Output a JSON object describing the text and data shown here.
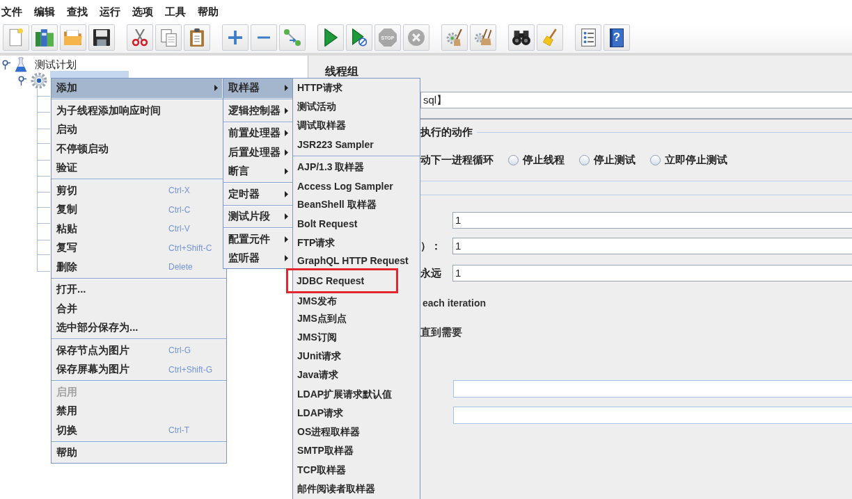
{
  "menubar": [
    "文件",
    "编辑",
    "查找",
    "运行",
    "选项",
    "工具",
    "帮助"
  ],
  "toolbar": [
    [
      {
        "kind": "new",
        "disabled": false
      },
      {
        "kind": "templates",
        "disabled": false
      },
      {
        "kind": "open",
        "disabled": false
      },
      {
        "kind": "save",
        "disabled": false
      }
    ],
    [
      {
        "kind": "cut",
        "disabled": false
      },
      {
        "kind": "copy",
        "disabled": false
      },
      {
        "kind": "paste",
        "disabled": false
      }
    ],
    [
      {
        "kind": "expand",
        "disabled": false
      },
      {
        "kind": "collapse",
        "disabled": false
      },
      {
        "kind": "toggle",
        "disabled": false
      }
    ],
    [
      {
        "kind": "start",
        "disabled": false
      },
      {
        "kind": "start_no_pauses",
        "disabled": false
      },
      {
        "kind": "stop",
        "label": "STOP",
        "disabled": true
      },
      {
        "kind": "shutdown",
        "disabled": true
      }
    ],
    [
      {
        "kind": "clear",
        "disabled": false
      },
      {
        "kind": "clear_all",
        "disabled": false
      }
    ],
    [
      {
        "kind": "search",
        "disabled": false
      },
      {
        "kind": "reset_search",
        "disabled": false
      }
    ],
    [
      {
        "kind": "functions",
        "disabled": false
      },
      {
        "kind": "help",
        "label": "?",
        "disabled": false
      }
    ]
  ],
  "tree": {
    "items": [
      {
        "label": "测试计划",
        "selected": false,
        "expanded": true,
        "children": [
          {
            "selected": true,
            "expanded": true
          }
        ]
      }
    ]
  },
  "panel": {
    "title": "线程组",
    "name_value": "sql】",
    "on_error": {
      "label": "执行的动作",
      "cut_option": "动下一进程循环",
      "options": [
        {
          "label": "停止线程",
          "selected": false
        },
        {
          "label": "停止测试",
          "selected": false
        },
        {
          "label": "立即停止测试",
          "selected": false
        }
      ]
    },
    "properties": [
      {
        "value": "1"
      },
      {
        "label": "）：",
        "value": "1"
      },
      {
        "label": "永远",
        "value": "1"
      }
    ],
    "same_user": "each iteration",
    "delay": "直到需要"
  },
  "context_menu": {
    "groups": [
      [
        {
          "label": "添加",
          "selected": true,
          "disabled": false,
          "submenu": true
        }
      ],
      [
        {
          "label": "为子线程添加响应时间",
          "selected": false,
          "disabled": false,
          "submenu": false
        },
        {
          "label": "启动",
          "selected": false,
          "disabled": false,
          "submenu": false
        },
        {
          "label": "不停顿启动",
          "selected": false,
          "disabled": false,
          "submenu": false
        },
        {
          "label": "验证",
          "selected": false,
          "disabled": false,
          "submenu": false
        }
      ],
      [
        {
          "label": "剪切",
          "shortcut": "Ctrl-X",
          "selected": false,
          "disabled": false,
          "submenu": false
        },
        {
          "label": "复制",
          "shortcut": "Ctrl-C",
          "selected": false,
          "disabled": false,
          "submenu": false
        },
        {
          "label": "粘贴",
          "shortcut": "Ctrl-V",
          "selected": false,
          "disabled": false,
          "submenu": false
        },
        {
          "label": "复写",
          "shortcut": "Ctrl+Shift-C",
          "selected": false,
          "disabled": false,
          "submenu": false
        },
        {
          "label": "删除",
          "shortcut": "Delete",
          "selected": false,
          "disabled": false,
          "submenu": false
        }
      ],
      [
        {
          "label": "打开...",
          "selected": false,
          "disabled": false,
          "submenu": false
        },
        {
          "label": "合并",
          "selected": false,
          "disabled": false,
          "submenu": false
        },
        {
          "label": "选中部分保存为...",
          "selected": false,
          "disabled": false,
          "submenu": false
        }
      ],
      [
        {
          "label": "保存节点为图片",
          "shortcut": "Ctrl-G",
          "selected": false,
          "disabled": false,
          "submenu": false
        },
        {
          "label": "保存屏幕为图片",
          "shortcut": "Ctrl+Shift-G",
          "selected": false,
          "disabled": false,
          "submenu": false
        }
      ],
      [
        {
          "label": "启用",
          "selected": false,
          "disabled": true,
          "submenu": false
        },
        {
          "label": "禁用",
          "selected": false,
          "disabled": false,
          "submenu": false
        },
        {
          "label": "切换",
          "shortcut": "Ctrl-T",
          "selected": false,
          "disabled": false,
          "submenu": false
        }
      ],
      [
        {
          "label": "帮助",
          "selected": false,
          "disabled": false,
          "submenu": false
        }
      ]
    ]
  },
  "add_menu": {
    "groups": [
      [
        {
          "label": "取样器",
          "selected": true,
          "submenu": true
        }
      ],
      [
        {
          "label": "逻辑控制器",
          "selected": false,
          "submenu": true
        }
      ],
      [
        {
          "label": "前置处理器",
          "selected": false,
          "submenu": true
        },
        {
          "label": "后置处理器",
          "selected": false,
          "submenu": true
        },
        {
          "label": "断言",
          "selected": false,
          "submenu": true
        }
      ],
      [
        {
          "label": "定时器",
          "selected": false,
          "submenu": true
        }
      ],
      [
        {
          "label": "测试片段",
          "selected": false,
          "submenu": true
        }
      ],
      [
        {
          "label": "配置元件",
          "selected": false,
          "submenu": true
        },
        {
          "label": "监听器",
          "selected": false,
          "submenu": true
        }
      ]
    ]
  },
  "sampler_menu": {
    "groups": [
      [
        {
          "label": "HTTP请求",
          "highlighted": false
        },
        {
          "label": "测试活动",
          "highlighted": false
        },
        {
          "label": "调试取样器",
          "highlighted": false
        },
        {
          "label": "JSR223 Sampler",
          "highlighted": false
        }
      ],
      [
        {
          "label": "AJP/1.3 取样器",
          "highlighted": false
        },
        {
          "label": "Access Log Sampler",
          "highlighted": false
        },
        {
          "label": "BeanShell 取样器",
          "highlighted": false
        },
        {
          "label": "Bolt Request",
          "highlighted": false
        },
        {
          "label": "FTP请求",
          "highlighted": false
        },
        {
          "label": "GraphQL HTTP Request",
          "highlighted": false
        },
        {
          "label": "JDBC Request",
          "highlighted": true
        },
        {
          "label": "JMS发布",
          "highlighted": false
        },
        {
          "label": "JMS点到点",
          "highlighted": false
        },
        {
          "label": "JMS订阅",
          "highlighted": false
        },
        {
          "label": "JUnit请求",
          "highlighted": false
        },
        {
          "label": "Java请求",
          "highlighted": false
        },
        {
          "label": "LDAP扩展请求默认值",
          "highlighted": false
        },
        {
          "label": "LDAP请求",
          "highlighted": false
        },
        {
          "label": "OS进程取样器",
          "highlighted": false
        },
        {
          "label": "SMTP取样器",
          "highlighted": false
        },
        {
          "label": "TCP取样器",
          "highlighted": false
        },
        {
          "label": "邮件阅读者取样器",
          "highlighted": false
        }
      ]
    ]
  }
}
